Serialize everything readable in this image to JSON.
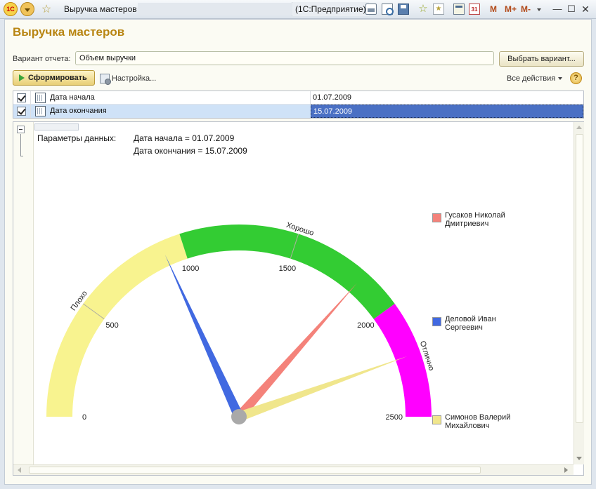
{
  "titlebar": {
    "logo": "1С",
    "window_title": "Выручка мастеров -",
    "app_name": "(1С:Предприятие)",
    "mem_buttons": [
      "M",
      "M+",
      "M-"
    ],
    "min": "—",
    "max": "☐",
    "close": "✕",
    "icons": [
      "print-icon",
      "print-preview-icon",
      "save-icon",
      "add-to-favorites-icon",
      "favorites-icon",
      "calculator-icon",
      "calendar-icon"
    ]
  },
  "page": {
    "title": "Выручка мастеров",
    "variant_label": "Вариант отчета:",
    "variant_value": "Объем выручки",
    "choose_variant": "Выбрать вариант...",
    "generate": "Сформировать",
    "settings": "Настройка...",
    "all_actions": "Все действия",
    "help": "?"
  },
  "params": [
    {
      "name": "Дата начала",
      "value": "01.07.2009",
      "checked": true
    },
    {
      "name": "Дата окончания",
      "value": "15.07.2009",
      "checked": true
    }
  ],
  "report": {
    "params_label": "Параметры данных:",
    "param_line_1": "Дата начала = 01.07.2009",
    "param_line_2": "Дата окончания = 15.07.2009"
  },
  "chart_data": {
    "type": "gauge",
    "min": 0,
    "max": 2500,
    "ticks": [
      0,
      500,
      1000,
      1500,
      2000,
      2500
    ],
    "bands": [
      {
        "label": "Плохо",
        "from": 0,
        "to": 1000,
        "color": "#f8f38f"
      },
      {
        "label": "Хорошо",
        "from": 1000,
        "to": 2000,
        "color": "#33cc33"
      },
      {
        "label": "Отлично",
        "from": 2000,
        "to": 2500,
        "color": "#ff00ff"
      }
    ],
    "series": [
      {
        "name": "Гусаков Николай Дмитриевич",
        "value": 1825,
        "color": "#f4827a"
      },
      {
        "name": "Деловой Иван Сергеевич",
        "value": 910,
        "color": "#4169e1"
      },
      {
        "name": "Симонов Валерий Михайлович",
        "value": 2225,
        "color": "#f0e68c"
      }
    ],
    "legend_position": "right",
    "colors": {
      "hub": "#a9a9a9",
      "band_divider": "#b0b0a0"
    }
  }
}
